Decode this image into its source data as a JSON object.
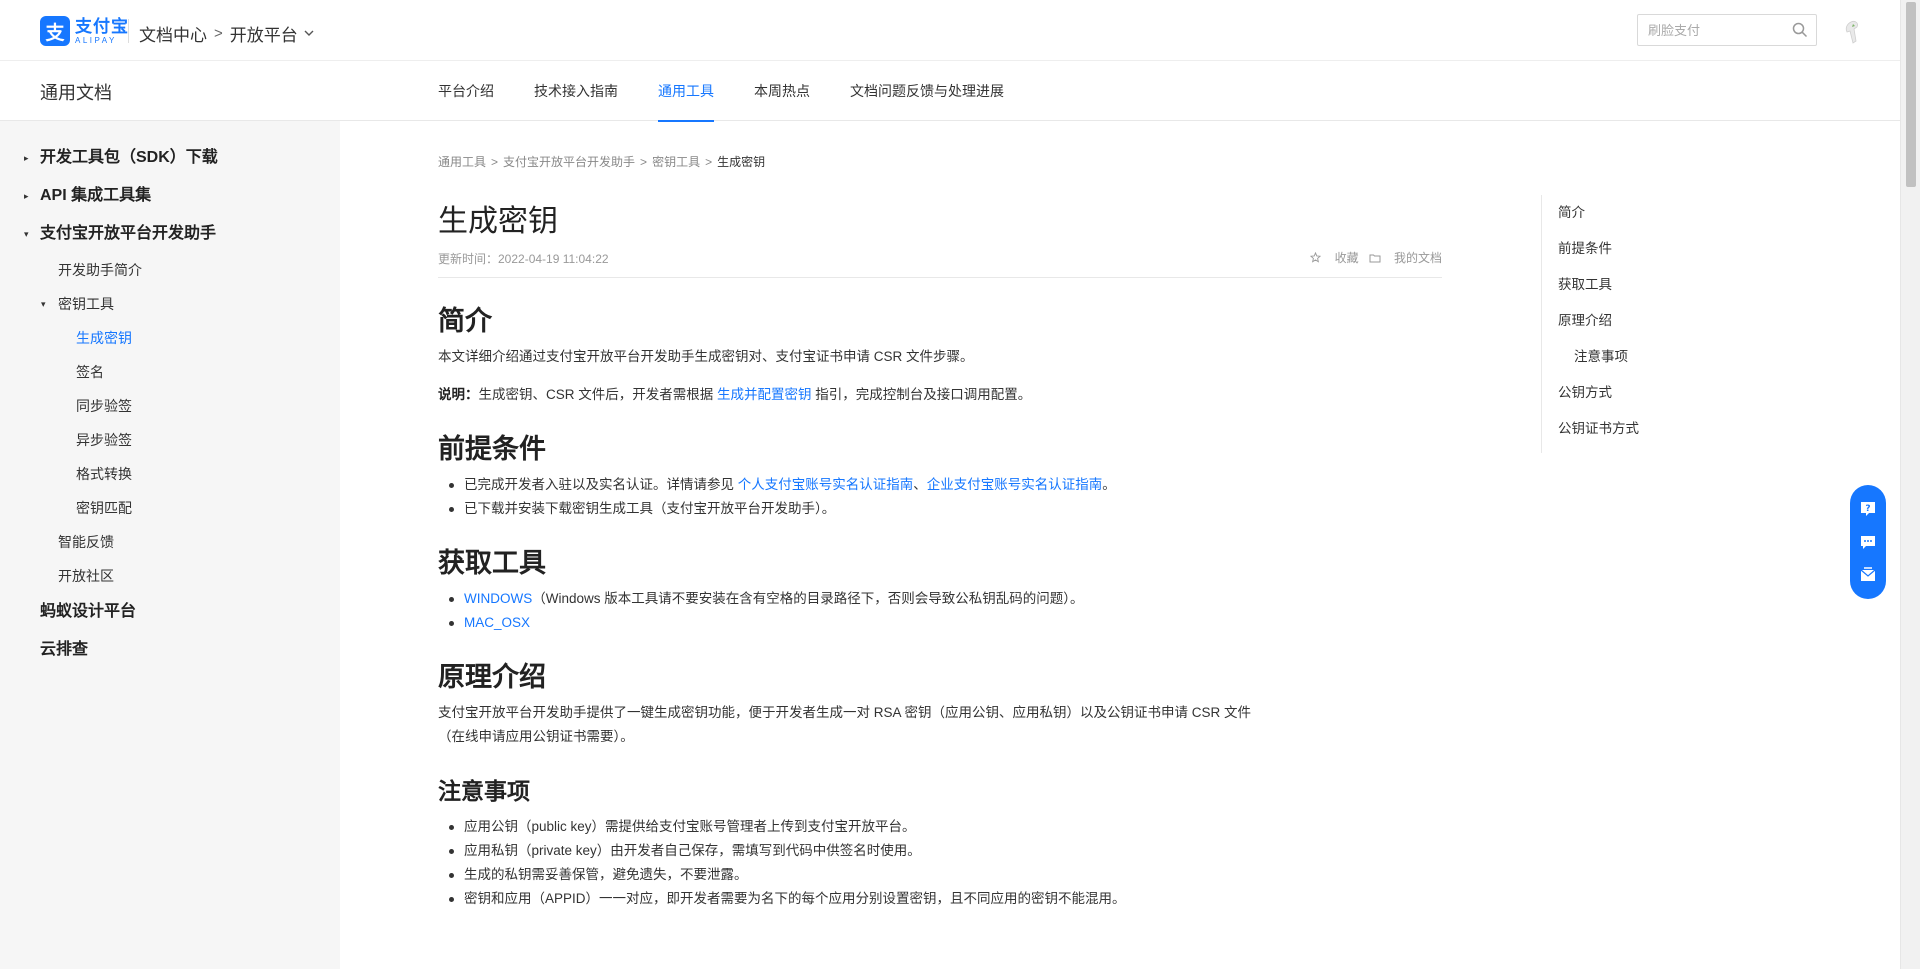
{
  "header": {
    "logo_cn": "支付宝",
    "logo_en": "ALIPAY",
    "crumb_root": "文档中心",
    "crumb_arrow": ">",
    "crumb_current": "开放平台",
    "search_placeholder": "刷脸支付"
  },
  "subnav": {
    "title": "通用文档",
    "tabs": [
      {
        "label": "平台介绍",
        "active": false
      },
      {
        "label": "技术接入指南",
        "active": false
      },
      {
        "label": "通用工具",
        "active": true
      },
      {
        "label": "本周热点",
        "active": false
      },
      {
        "label": "文档问题反馈与处理进展",
        "active": false
      }
    ]
  },
  "sidebar": {
    "items": [
      {
        "label": "开发工具包（SDK）下载",
        "level": 1,
        "caret": "▸"
      },
      {
        "label": "API 集成工具集",
        "level": 1,
        "caret": "▸"
      },
      {
        "label": "支付宝开放平台开发助手",
        "level": 1,
        "caret": "▾"
      },
      {
        "label": "开发助手简介",
        "level": 2
      },
      {
        "label": "密钥工具",
        "level": 2,
        "caret": "▾"
      },
      {
        "label": "生成密钥",
        "level": 3,
        "active": true
      },
      {
        "label": "签名",
        "level": 3
      },
      {
        "label": "同步验签",
        "level": 3
      },
      {
        "label": "异步验签",
        "level": 3
      },
      {
        "label": "格式转换",
        "level": 3
      },
      {
        "label": "密钥匹配",
        "level": 3
      },
      {
        "label": "智能反馈",
        "level": 2
      },
      {
        "label": "开放社区",
        "level": 2
      },
      {
        "label": "蚂蚁设计平台",
        "level": 1
      },
      {
        "label": "云排查",
        "level": 1
      }
    ]
  },
  "breadcrumb": {
    "items": [
      "通用工具",
      "支付宝开放平台开发助手",
      "密钥工具"
    ],
    "current": "生成密钥",
    "sep": ">"
  },
  "doc": {
    "title": "生成密钥",
    "updated": "更新时间：2022-04-19 11:04:22",
    "favorite": "收藏",
    "my_docs": "我的文档",
    "intro": {
      "heading": "简介",
      "para": "本文详细介绍通过支付宝开放平台开发助手生成密钥对、支付宝证书申请 CSR 文件步骤。",
      "note_label": "说明：",
      "note_text1": "生成密钥、CSR 文件后，开发者需根据 ",
      "note_link": "生成并配置密钥",
      "note_text2": " 指引，完成控制台及接口调用配置。"
    },
    "prereq": {
      "heading": "前提条件",
      "h1_mark": "H1",
      "item1_text": "已完成开发者入驻以及实名认证。详情请参见 ",
      "item1_link1": "个人支付宝账号实名认证指南",
      "item1_sep": "、",
      "item1_link2": "企业支付宝账号实名认证指南",
      "item1_end": "。",
      "item2": "已下载并安装下载密钥生成工具（支付宝开放平台开发助手）。"
    },
    "tools": {
      "heading": "获取工具",
      "win_link": "WINDOWS",
      "win_note": "（Windows 版本工具请不要安装在含有空格的目录路径下，否则会导致公私钥乱码的问题）。",
      "mac_link": "MAC_OSX"
    },
    "principle": {
      "heading": "原理介绍",
      "para": "支付宝开放平台开发助手提供了一键生成密钥功能，便于开发者生成一对 RSA 密钥（应用公钥、应用私钥）以及公钥证书申请 CSR 文件（在线申请应用公钥证书需要）。"
    },
    "notes": {
      "heading": "注意事项",
      "items": [
        "应用公钥（public key）需提供给支付宝账号管理者上传到支付宝开放平台。",
        "应用私钥（private key）由开发者自己保存，需填写到代码中供签名时使用。",
        "生成的私钥需妥善保管，避免遗失，不要泄露。",
        "密钥和应用（APPID）一一对应，即开发者需要为名下的每个应用分别设置密钥，且不同应用的密钥不能混用。"
      ]
    }
  },
  "toc": {
    "items": [
      {
        "label": "简介",
        "sub": false
      },
      {
        "label": "前提条件",
        "sub": false
      },
      {
        "label": "获取工具",
        "sub": false
      },
      {
        "label": "原理介绍",
        "sub": false
      },
      {
        "label": "注意事项",
        "sub": true
      },
      {
        "label": "公钥方式",
        "sub": false
      },
      {
        "label": "公钥证书方式",
        "sub": false
      }
    ]
  },
  "colors": {
    "brand": "#1677ff",
    "sidebar_bg": "#f6f6f6",
    "text": "#333333"
  },
  "icons": {
    "search": "search-icon",
    "star": "star-icon",
    "folder": "folder-icon",
    "help": "question-icon",
    "chat": "chat-icon",
    "mail": "mail-icon"
  }
}
